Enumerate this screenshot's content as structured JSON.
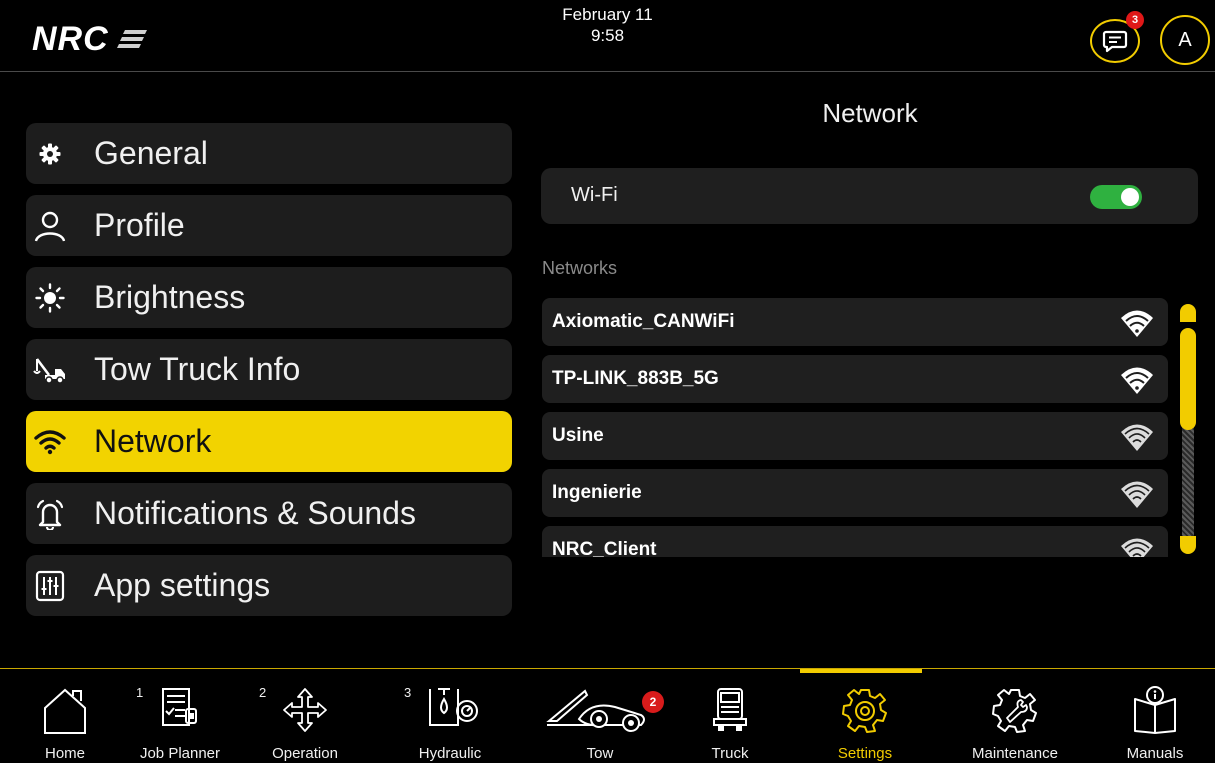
{
  "header": {
    "brand": "NRC",
    "date": "February 11",
    "time": "9:58",
    "notifications_count": "3",
    "avatar_initial": "A",
    "accent_color": "#f2cc00"
  },
  "settings_menu": {
    "items": [
      {
        "label": "General",
        "icon": "gear-icon"
      },
      {
        "label": "Profile",
        "icon": "user-icon"
      },
      {
        "label": "Brightness",
        "icon": "sun-icon"
      },
      {
        "label": "Tow Truck Info",
        "icon": "tow-truck-icon"
      },
      {
        "label": "Network",
        "icon": "wifi-icon",
        "active": true
      },
      {
        "label": "Notifications & Sounds",
        "icon": "bell-icon"
      },
      {
        "label": "App settings",
        "icon": "sliders-icon"
      }
    ]
  },
  "network": {
    "title": "Network",
    "wifi_label": "Wi-Fi",
    "wifi_enabled": true,
    "toggle_color": "#2fb140",
    "networks_label": "Networks",
    "networks": [
      {
        "name": "Axiomatic_CANWiFi",
        "signal": "strong"
      },
      {
        "name": "TP-LINK_883B_5G",
        "signal": "strong"
      },
      {
        "name": "Usine",
        "signal": "weak"
      },
      {
        "name": "Ingenierie",
        "signal": "weak"
      },
      {
        "name": "NRC_Client",
        "signal": "weak"
      }
    ]
  },
  "bottom_nav": {
    "items": [
      {
        "label": "Home",
        "icon": "home-icon"
      },
      {
        "label": "Job Planner",
        "icon": "job-planner-icon",
        "number": "1"
      },
      {
        "label": "Operation",
        "icon": "move-arrows-icon",
        "number": "2"
      },
      {
        "label": "Hydraulic",
        "icon": "hydraulic-icon",
        "number": "3"
      },
      {
        "label": "Tow",
        "icon": "tow-icon",
        "badge": "2"
      },
      {
        "label": "Truck",
        "icon": "truck-icon"
      },
      {
        "label": "Settings",
        "icon": "settings-gear-icon",
        "active": true
      },
      {
        "label": "Maintenance",
        "icon": "maintenance-icon"
      },
      {
        "label": "Manuals",
        "icon": "manual-icon"
      }
    ]
  }
}
